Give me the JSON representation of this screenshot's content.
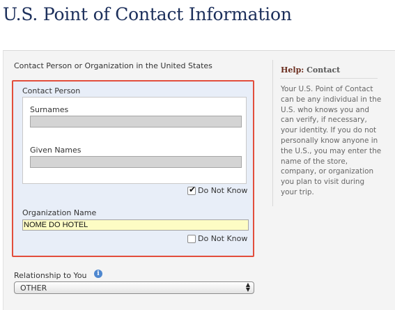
{
  "page": {
    "title": "U.S. Point of Contact Information"
  },
  "form": {
    "section_label": "Contact Person or Organization in the United States",
    "contact_person": {
      "label": "Contact Person",
      "surnames_label": "Surnames",
      "surnames_value": "",
      "given_names_label": "Given Names",
      "given_names_value": "",
      "do_not_know_label": "Do Not Know",
      "do_not_know_checked": true
    },
    "organization": {
      "label": "Organization Name",
      "value": "NOME DO HOTEL",
      "do_not_know_label": "Do Not Know",
      "do_not_know_checked": false
    },
    "relationship": {
      "label": "Relationship to You",
      "info_icon": "info-icon",
      "selected": "OTHER"
    }
  },
  "help": {
    "prefix": "Help:",
    "topic": "Contact",
    "body": "Your U.S. Point of Contact can be any individual in the U.S. who knows you and can verify, if necessary, your identity. If you do not personally know anyone in the U.S., you may enter the name of the store, company, or organization you plan to visit during your trip."
  },
  "colors": {
    "title": "#1c2f5b",
    "highlight_border": "#e24e3c",
    "highlight_fill": "#e8eef8",
    "active_field": "#fdfcc4",
    "help_title": "#6a2c1d"
  }
}
